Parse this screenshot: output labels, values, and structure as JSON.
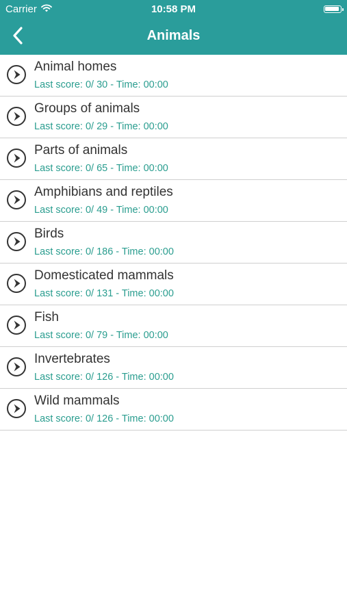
{
  "status_bar": {
    "carrier": "Carrier",
    "time": "10:58 PM"
  },
  "nav": {
    "title": "Animals",
    "back_icon": "chevron-left-icon"
  },
  "colors": {
    "header_bg": "#2a9d9b",
    "subtitle_text": "#2a9d8f",
    "row_icon": "#333333"
  },
  "categories": [
    {
      "title": "Animal homes",
      "subtitle": "Last score: 0/ 30 - Time: 00:00"
    },
    {
      "title": "Groups of animals",
      "subtitle": "Last score: 0/ 29 - Time: 00:00"
    },
    {
      "title": "Parts of animals",
      "subtitle": "Last score: 0/ 65 - Time: 00:00"
    },
    {
      "title": "Amphibians and reptiles",
      "subtitle": "Last score: 0/ 49 - Time: 00:00"
    },
    {
      "title": "Birds",
      "subtitle": "Last score: 0/ 186 - Time: 00:00"
    },
    {
      "title": "Domesticated mammals",
      "subtitle": "Last score: 0/ 131 - Time: 00:00"
    },
    {
      "title": "Fish",
      "subtitle": "Last score: 0/ 79 - Time: 00:00"
    },
    {
      "title": "Invertebrates",
      "subtitle": "Last score: 0/ 126 - Time: 00:00"
    },
    {
      "title": "Wild mammals",
      "subtitle": "Last score: 0/ 126 - Time: 00:00"
    }
  ]
}
